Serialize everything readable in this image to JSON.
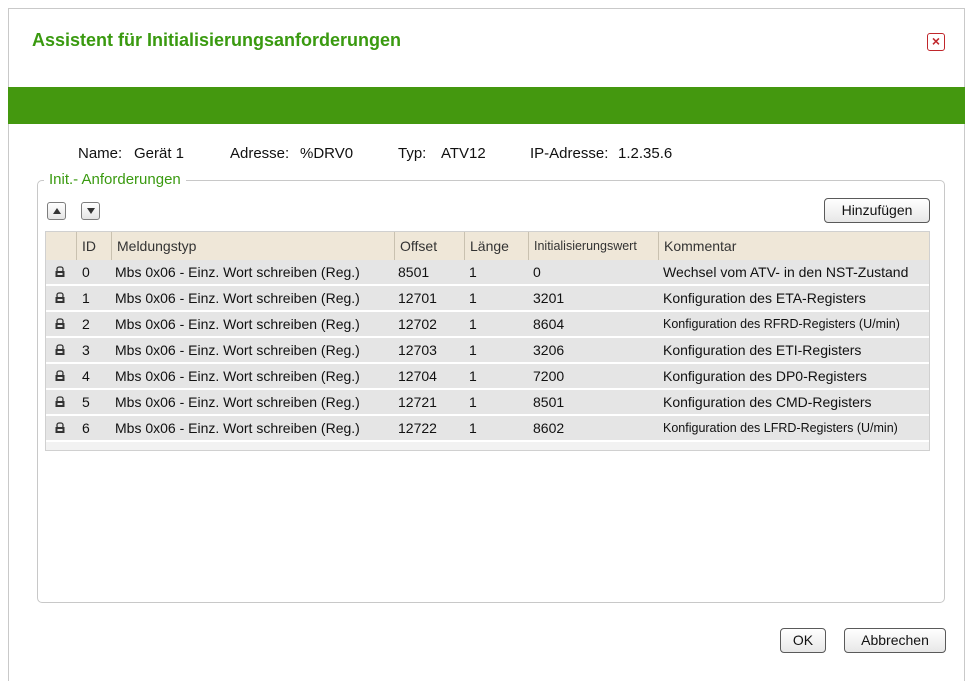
{
  "dialog": {
    "title": "Assistent für Initialisierungsanforderungen",
    "close_label": "×"
  },
  "device": {
    "name_label": "Name:",
    "name_value": "Gerät 1",
    "address_label": "Adresse:",
    "address_value": "%DRV0",
    "type_label": "Typ:",
    "type_value": "ATV12",
    "ip_label": "IP-Adresse:",
    "ip_value": "1.2.35.6"
  },
  "requests": {
    "group_label": "Init.- Anforderungen",
    "add_button": "Hinzufügen",
    "columns": [
      "ID",
      "Meldungstyp",
      "Offset",
      "Länge",
      "Initialisierungswert",
      "Kommentar"
    ],
    "rows": [
      {
        "id": "0",
        "type": "Mbs 0x06 - Einz. Wort schreiben (Reg.)",
        "offset": "8501",
        "length": "1",
        "init_value": "0",
        "comment": "Wechsel vom ATV- in den NST-Zustand"
      },
      {
        "id": "1",
        "type": "Mbs 0x06 - Einz. Wort schreiben (Reg.)",
        "offset": "12701",
        "length": "1",
        "init_value": "3201",
        "comment": "Konfiguration des ETA-Registers"
      },
      {
        "id": "2",
        "type": "Mbs 0x06 - Einz. Wort schreiben (Reg.)",
        "offset": "12702",
        "length": "1",
        "init_value": "8604",
        "comment": "Konfiguration des RFRD-Registers (U/min)"
      },
      {
        "id": "3",
        "type": "Mbs 0x06 - Einz. Wort schreiben (Reg.)",
        "offset": "12703",
        "length": "1",
        "init_value": "3206",
        "comment": "Konfiguration des ETI-Registers"
      },
      {
        "id": "4",
        "type": "Mbs 0x06 - Einz. Wort schreiben (Reg.)",
        "offset": "12704",
        "length": "1",
        "init_value": "7200",
        "comment": "Konfiguration des DP0-Registers"
      },
      {
        "id": "5",
        "type": "Mbs 0x06 - Einz. Wort schreiben (Reg.)",
        "offset": "12721",
        "length": "1",
        "init_value": "8501",
        "comment": "Konfiguration des CMD-Registers"
      },
      {
        "id": "6",
        "type": "Mbs 0x06 - Einz. Wort schreiben (Reg.)",
        "offset": "12722",
        "length": "1",
        "init_value": "8602",
        "comment": "Konfiguration des LFRD-Registers (U/min)"
      }
    ]
  },
  "footer": {
    "ok_label": "OK",
    "cancel_label": "Abbrechen"
  },
  "colors": {
    "accent_green": "#44980f",
    "title_green": "#3a9a10",
    "close_red": "#c0262b"
  }
}
